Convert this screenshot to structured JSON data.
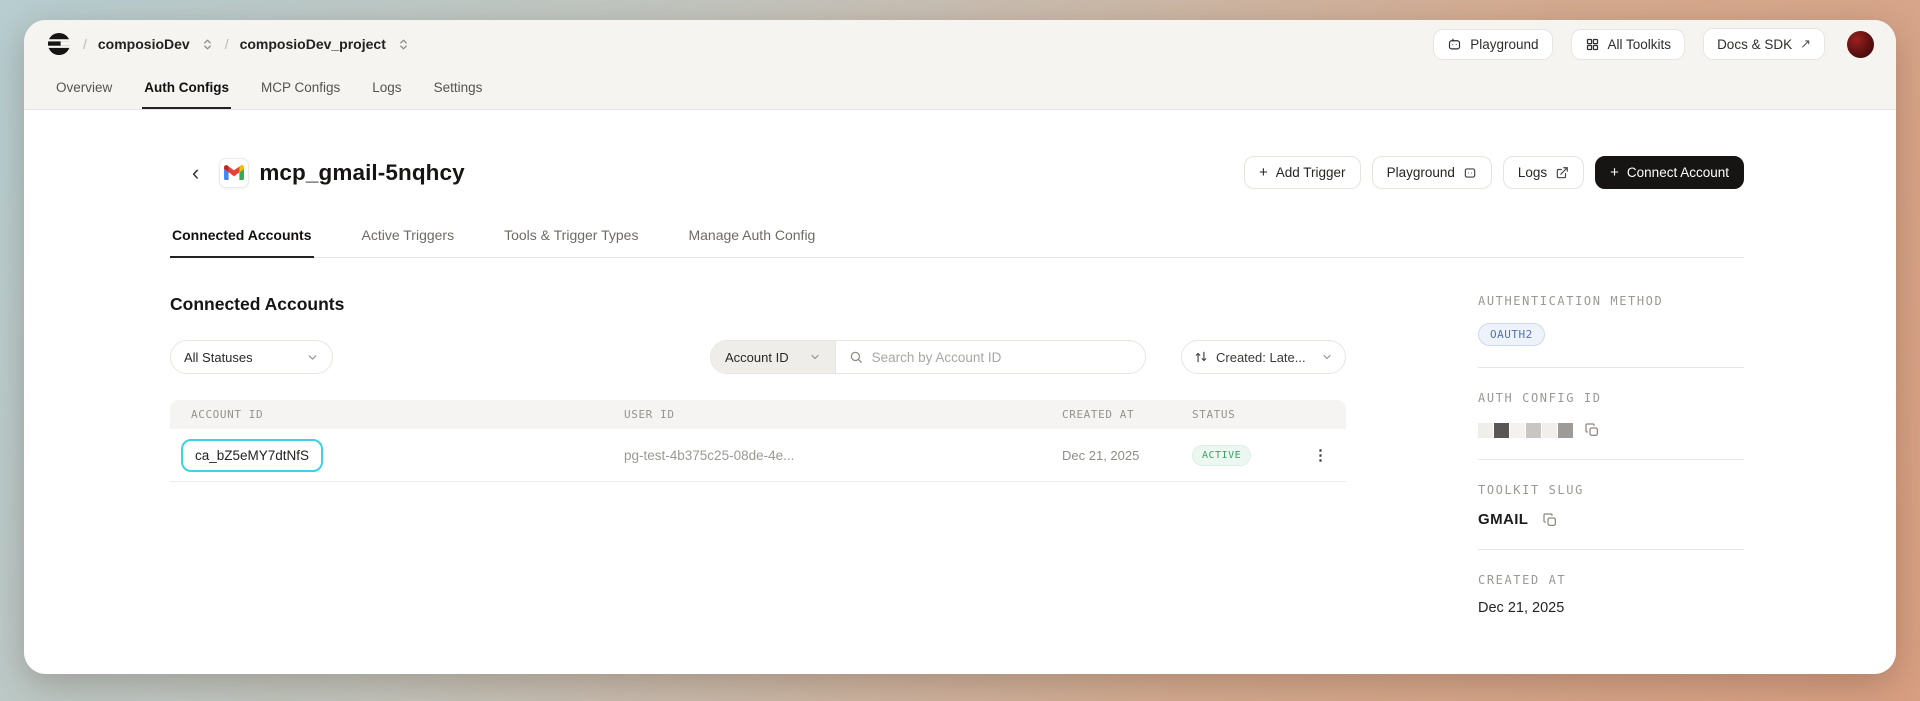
{
  "topbar": {
    "separator": "/",
    "org": "composioDev",
    "project": "composioDev_project",
    "playground_label": "Playground",
    "all_toolkits_label": "All Toolkits",
    "docs_label": "Docs & SDK",
    "docs_arrow": "↗"
  },
  "nav_tabs": {
    "t0": "Overview",
    "t1": "Auth Configs",
    "t2": "MCP Configs",
    "t3": "Logs",
    "t4": "Settings"
  },
  "page_header": {
    "back_icon": "‹",
    "title": "mcp_gmail-5nqhcy",
    "plus": "+",
    "add_trigger": "Add Trigger",
    "playground": "Playground",
    "logs": "Logs",
    "connect_account": "Connect Account"
  },
  "sub_tabs": {
    "t0": "Connected Accounts",
    "t1": "Active Triggers",
    "t2": "Tools & Trigger Types",
    "t3": "Manage Auth Config"
  },
  "accounts": {
    "heading": "Connected Accounts",
    "status_filter": "All Statuses",
    "search_field_label": "Account ID",
    "search_placeholder": "Search by Account ID",
    "sort_label": "Created: Late...",
    "columns": {
      "c0": "ACCOUNT ID",
      "c1": "USER ID",
      "c2": "CREATED AT",
      "c3": "STATUS"
    },
    "row": {
      "account_id": "ca_bZ5eMY7dtNfS",
      "user_id": "pg-test-4b375c25-08de-4e...",
      "created_at": "Dec 21, 2025",
      "status": "ACTIVE",
      "menu_icon": "⋮"
    }
  },
  "sidebar": {
    "auth_method_label": "AUTHENTICATION METHOD",
    "auth_method_value": "OAUTH2",
    "auth_config_id_label": "AUTH CONFIG ID",
    "toolkit_slug_label": "TOOLKIT SLUG",
    "toolkit_slug_value": "GMAIL",
    "created_at_label": "CREATED AT",
    "created_at_value": "Dec 21, 2025"
  },
  "colors": {
    "highlight_cyan": "#3ed2e7",
    "status_green": "#3d9f66",
    "oauth_blue": "#4f74b3",
    "connect_button_bg": "#161514",
    "bg_gradient_top": "#b7cdd0",
    "bg_gradient_bottom": "#d99f82"
  }
}
